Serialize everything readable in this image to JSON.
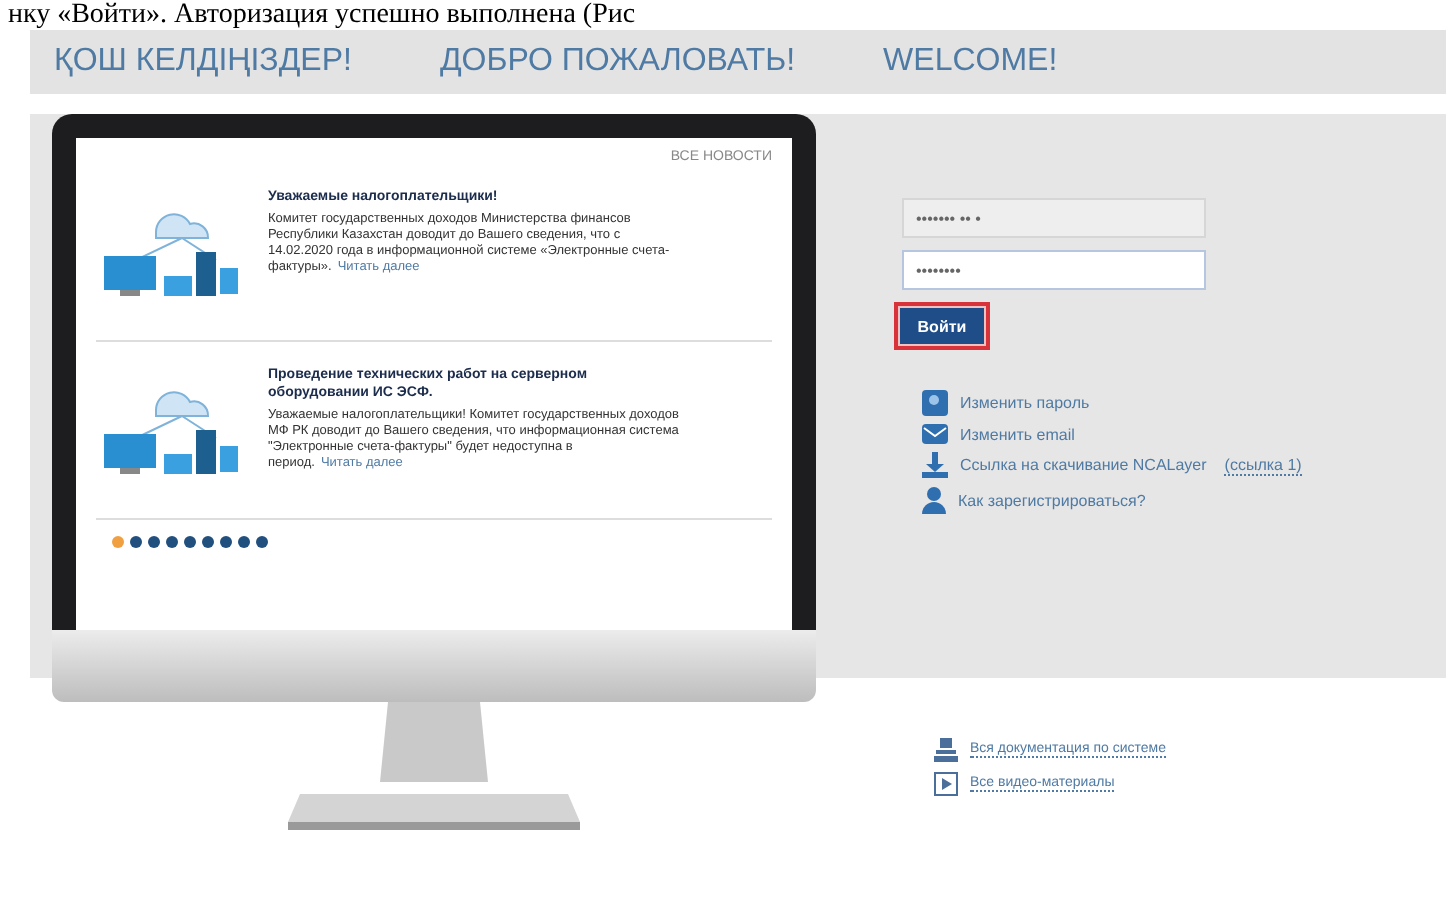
{
  "document_line": "нку «Войти». Авторизация успешно выполнена (Рис",
  "header": {
    "greetings": [
      "ҚОШ КЕЛДІҢІЗДЕР!",
      "ДОБРО ПОЖАЛОВАТЬ!",
      "WELCOME!"
    ]
  },
  "news": {
    "all_link": "ВСЕ НОВОСТИ",
    "items": [
      {
        "title": "Уважаемые налогоплательщики!",
        "text": "Комитет государственных доходов Министерства финансов Республики Казахстан доводит до Вашего сведения, что с 14.02.2020 года в информационной системе «Электронные счета-фактуры».",
        "more": "Читать далее"
      },
      {
        "title": "Проведение технических работ на серверном оборудовании ИС ЭСФ.",
        "text": "Уважаемые налогоплательщики! Комитет государственных доходов МФ РК доводит до Вашего сведения, что информационная система \"Электронные счета-фактуры\" будет недоступна в период.",
        "more": "Читать далее"
      }
    ],
    "dots": [
      {
        "selected": true
      },
      {
        "selected": false
      },
      {
        "selected": false
      },
      {
        "selected": false
      },
      {
        "selected": false
      },
      {
        "selected": false
      },
      {
        "selected": false
      },
      {
        "selected": false
      },
      {
        "selected": false
      }
    ]
  },
  "login": {
    "username": "••••••• •• •",
    "password": "••••••••",
    "button": "Войти",
    "button_highlighted": true
  },
  "links": [
    {
      "kind": "password",
      "label": "Изменить пароль"
    },
    {
      "kind": "email",
      "label": "Изменить email"
    },
    {
      "kind": "download",
      "label": "Ссылка на скачивание NCALayer",
      "extra": "(ссылка 1)"
    },
    {
      "kind": "register",
      "label": "Как зарегистрироваться?"
    }
  ],
  "bottom_links": [
    {
      "kind": "docs",
      "label": "Вся документация по системе"
    },
    {
      "kind": "video",
      "label": "Все видео-материалы"
    }
  ]
}
